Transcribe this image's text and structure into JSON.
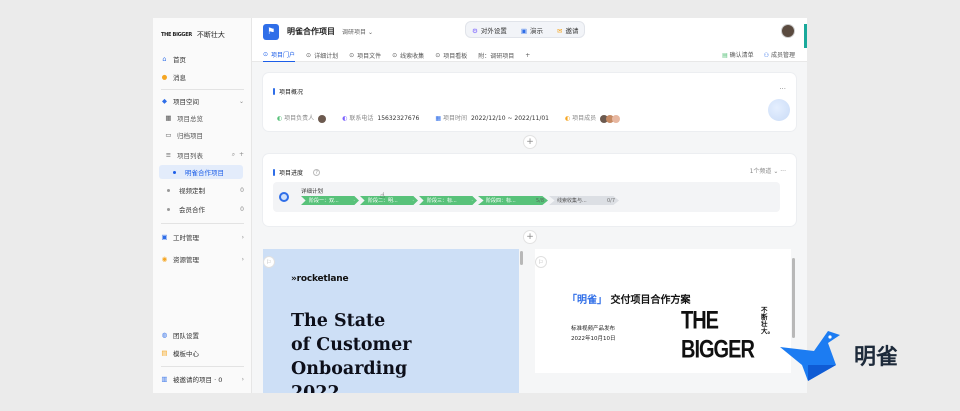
{
  "sidebar": {
    "brand_logo": "THE BIGGER",
    "brand_name": "不断壮大",
    "nav": [
      {
        "label": "首页",
        "icon": "home-icon"
      },
      {
        "label": "消息",
        "icon": "bell-icon"
      }
    ],
    "space_label": "项目空间",
    "space_items": [
      {
        "label": "项目总览",
        "icon": "grid-icon"
      },
      {
        "label": "归档项目",
        "icon": "archive-icon"
      }
    ],
    "project_list_label": "项目列表",
    "projects": [
      {
        "label": "明雀合作项目",
        "count": "",
        "active": true
      },
      {
        "label": "视频定制",
        "count": "0",
        "active": false
      },
      {
        "label": "会员合作",
        "count": "0",
        "active": false
      }
    ],
    "bottom_groups": [
      {
        "label": "工时管理"
      },
      {
        "label": "资源管理"
      }
    ],
    "footer": [
      {
        "label": "团队设置"
      },
      {
        "label": "模板中心"
      }
    ],
    "invited_label": "被邀请的项目 · 0"
  },
  "header": {
    "project_title": "明雀合作项目",
    "project_status": "调研项目",
    "actions": [
      "对外设置",
      "演示",
      "邀请"
    ],
    "tabs": [
      {
        "label": "项目门户",
        "active": true
      },
      {
        "label": "详细计划",
        "active": false
      },
      {
        "label": "项目文件",
        "active": false
      },
      {
        "label": "线索收集",
        "active": false
      },
      {
        "label": "项目看板",
        "active": false
      },
      {
        "label": "附：调研项目",
        "active": false
      }
    ],
    "add_tab": "+",
    "right_actions": [
      "确认清单",
      "成员管理"
    ]
  },
  "overview": {
    "title": "项目概况",
    "more": "···",
    "owner_label": "项目负责人",
    "phone_label": "联系电话",
    "phone_value": "15632327676",
    "time_label": "项目时间",
    "time_value": "2022/12/10 ~ 2022/11/01",
    "members_label": "项目成员"
  },
  "progress": {
    "title": "项目进度",
    "help": "?",
    "filter": "1个频道",
    "plan_label": "详细计划",
    "stages": [
      {
        "label": "阶段一：双...",
        "count": "",
        "done": true
      },
      {
        "label": "阶段二：明...",
        "count": "",
        "done": true
      },
      {
        "label": "阶段三：标...",
        "count": "",
        "done": true
      },
      {
        "label": "阶段四：标...",
        "count": "5/8",
        "done": true
      },
      {
        "label": "线索收集与...",
        "count": "0/7",
        "done": false
      }
    ]
  },
  "slides": {
    "left_brand": "»rocketlane",
    "left_title": "The State\nof Customer\nOnboarding\n2022",
    "right_title_quoted": "「明雀」",
    "right_title_rest": "交付项目合作方案",
    "right_sub1": "标准视频产品发布",
    "right_sub2": "2022年10月10日",
    "right_brand": "THE BIGGER",
    "right_brand_side": "不断壮大。"
  },
  "external_brand": {
    "name": "明雀",
    "color": "#1c7cf2"
  },
  "colors": {
    "accent": "#1c5ee8",
    "done_stage": "#58c27a",
    "slide_bg": "#cddff6"
  }
}
